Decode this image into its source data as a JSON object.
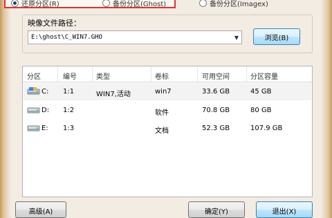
{
  "mode_radios": [
    {
      "label": "还原分区(R)",
      "selected": true
    },
    {
      "label": "备份分区(Ghost)",
      "selected": false
    },
    {
      "label": "备份分区(Imagex)",
      "selected": false
    }
  ],
  "image_path": {
    "title": "映像文件路径：",
    "value": "E:\\ghost\\C_WIN7.GHO",
    "browse_label": "浏览(B)"
  },
  "partition_table": {
    "columns": [
      "分区",
      "编号",
      "类型",
      "卷标",
      "可用空间",
      "分区容量"
    ],
    "rows": [
      {
        "drive": "C:",
        "number": "1:1",
        "type": "WIN7,活动",
        "label": "win7",
        "free": "33.6 GB",
        "capacity": "45 GB",
        "selected": true
      },
      {
        "drive": "D:",
        "number": "1:2",
        "type": "",
        "label": "软件",
        "free": "70.8 GB",
        "capacity": "80 GB",
        "selected": false
      },
      {
        "drive": "E:",
        "number": "1:3",
        "type": "",
        "label": "文档",
        "free": "52.3 GB",
        "capacity": "107.9 GB",
        "selected": false
      }
    ]
  },
  "bottom_buttons": [
    {
      "label": "高级(A)"
    },
    {
      "label": "确定(Y)"
    },
    {
      "label": "退出(X)"
    }
  ]
}
